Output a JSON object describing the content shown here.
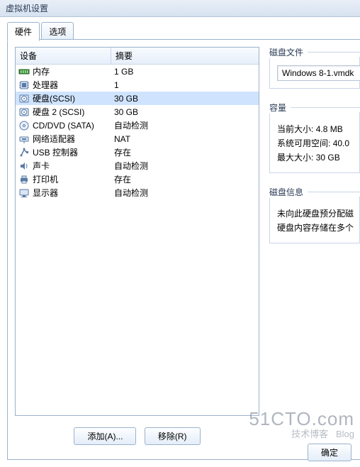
{
  "window": {
    "title": "虚拟机设置"
  },
  "tabs": {
    "hardware": "硬件",
    "options": "选项"
  },
  "device_list": {
    "header_device": "设备",
    "header_summary": "摘要",
    "rows": [
      {
        "icon": "memory",
        "name": "内存",
        "summary": "1 GB"
      },
      {
        "icon": "cpu",
        "name": "处理器",
        "summary": "1"
      },
      {
        "icon": "disk",
        "name": "硬盘(SCSI)",
        "summary": "30 GB",
        "selected": true
      },
      {
        "icon": "disk",
        "name": "硬盘 2 (SCSI)",
        "summary": "30 GB"
      },
      {
        "icon": "cd",
        "name": "CD/DVD (SATA)",
        "summary": "自动检测"
      },
      {
        "icon": "net",
        "name": "网络适配器",
        "summary": "NAT"
      },
      {
        "icon": "usb",
        "name": "USB 控制器",
        "summary": "存在"
      },
      {
        "icon": "sound",
        "name": "声卡",
        "summary": "自动检测"
      },
      {
        "icon": "printer",
        "name": "打印机",
        "summary": "存在"
      },
      {
        "icon": "display",
        "name": "显示器",
        "summary": "自动检测"
      }
    ]
  },
  "buttons": {
    "add": "添加(A)...",
    "remove": "移除(R)",
    "ok": "确定"
  },
  "right": {
    "disk_file_label": "磁盘文件",
    "disk_file_value": "Windows 8-1.vmdk",
    "capacity_label": "容量",
    "current_size_label": "当前大小:",
    "current_size_value": "4.8 MB",
    "free_space_label": "系统可用空间:",
    "free_space_value": "40.0",
    "max_size_label": "最大大小:",
    "max_size_value": "30 GB",
    "disk_info_label": "磁盘信息",
    "info_line1": "未向此硬盘预分配磁",
    "info_line2": "硬盘内容存储在多个"
  },
  "watermark": {
    "big": "51CTO.com",
    "small1": "技术博客",
    "small2": "Blog"
  }
}
